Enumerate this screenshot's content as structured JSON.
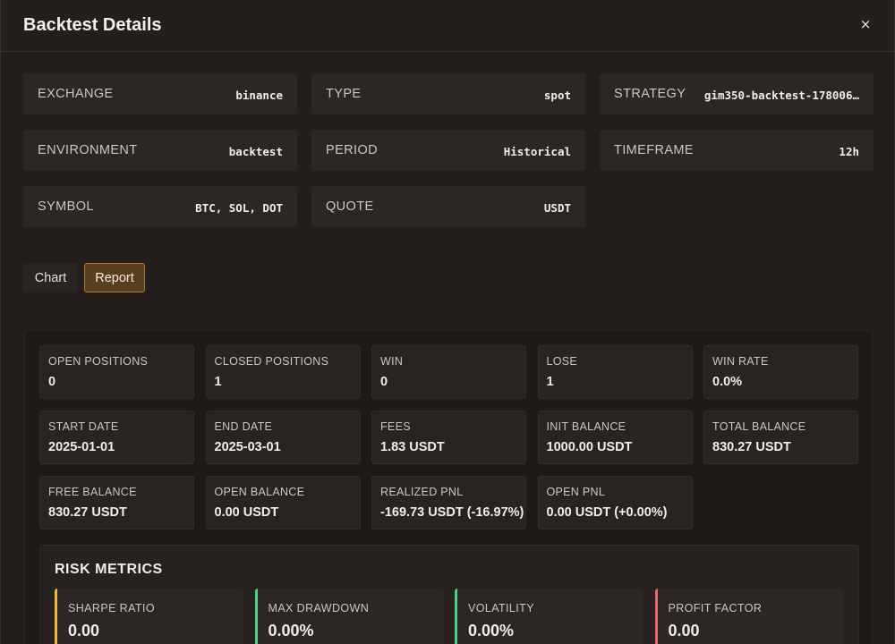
{
  "header": {
    "title": "Backtest Details",
    "close_label": "×"
  },
  "info": [
    {
      "label": "EXCHANGE",
      "value": "binance"
    },
    {
      "label": "TYPE",
      "value": "spot"
    },
    {
      "label": "STRATEGY",
      "value": "gim350-backtest-178006…"
    },
    {
      "label": "ENVIRONMENT",
      "value": "backtest"
    },
    {
      "label": "PERIOD",
      "value": "Historical"
    },
    {
      "label": "TIMEFRAME",
      "value": "12h"
    },
    {
      "label": "SYMBOL",
      "value": "BTC, SOL, DOT"
    },
    {
      "label": "QUOTE",
      "value": "USDT"
    }
  ],
  "tabs": {
    "chart": "Chart",
    "report": "Report",
    "active": "report"
  },
  "stats": [
    {
      "label": "OPEN POSITIONS",
      "value": "0"
    },
    {
      "label": "CLOSED POSITIONS",
      "value": "1"
    },
    {
      "label": "WIN",
      "value": "0"
    },
    {
      "label": "LOSE",
      "value": "1"
    },
    {
      "label": "WIN RATE",
      "value": "0.0%"
    },
    {
      "label": "START DATE",
      "value": "2025-01-01"
    },
    {
      "label": "END DATE",
      "value": "2025-03-01"
    },
    {
      "label": "FEES",
      "value": "1.83 USDT"
    },
    {
      "label": "INIT BALANCE",
      "value": "1000.00 USDT"
    },
    {
      "label": "TOTAL BALANCE",
      "value": "830.27 USDT"
    },
    {
      "label": "FREE BALANCE",
      "value": "830.27 USDT"
    },
    {
      "label": "OPEN BALANCE",
      "value": "0.00 USDT"
    },
    {
      "label": "REALIZED PNL",
      "value": "-169.73 USDT (-16.97%)"
    },
    {
      "label": "OPEN PNL",
      "value": "0.00 USDT (+0.00%)"
    }
  ],
  "risk": {
    "title": "RISK METRICS",
    "metrics": [
      {
        "label": "SHARPE RATIO",
        "value": "0.00",
        "accent": "#f0b93a"
      },
      {
        "label": "MAX DRAWDOWN",
        "value": "0.00%",
        "accent": "#4fd18b"
      },
      {
        "label": "VOLATILITY",
        "value": "0.00%",
        "accent": "#4fd18b"
      },
      {
        "label": "PROFIT FACTOR",
        "value": "0.00",
        "accent": "#e86a6a"
      }
    ]
  },
  "colors": {
    "accent_gold": "#b07a34",
    "background": "#231e1b"
  }
}
